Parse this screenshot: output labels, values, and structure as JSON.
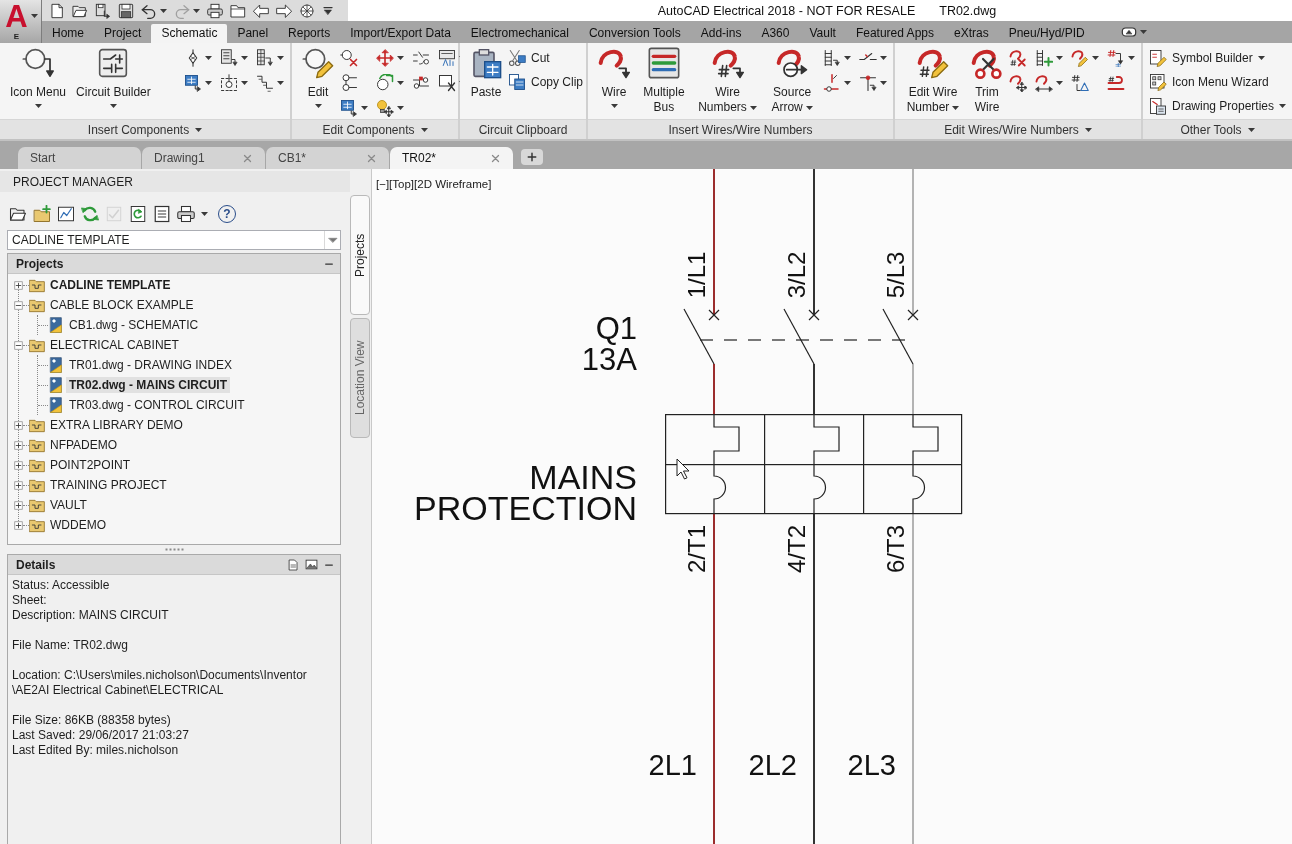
{
  "app_button": {
    "logo": "A",
    "label": "E"
  },
  "quick_access": [
    {
      "disabled": false
    },
    {
      "disabled": false
    },
    {
      "disabled": false
    },
    {
      "disabled": false
    },
    {
      "disabled": false
    },
    {
      "disabled": true
    },
    {
      "disabled": false
    },
    {
      "disabled": false
    },
    {
      "disabled": false
    },
    {
      "disabled": false
    },
    {
      "disabled": false
    }
  ],
  "window": {
    "title": "AutoCAD Electrical 2018 - NOT FOR RESALE",
    "document": "TR02.dwg"
  },
  "ribbon_tabs": [
    {
      "label": "Home",
      "selected": false
    },
    {
      "label": "Project",
      "selected": false
    },
    {
      "label": "Schematic",
      "selected": true
    },
    {
      "label": "Panel",
      "selected": false
    },
    {
      "label": "Reports",
      "selected": false
    },
    {
      "label": "Import/Export Data",
      "selected": false
    },
    {
      "label": "Electromechanical",
      "selected": false
    },
    {
      "label": "Conversion Tools",
      "selected": false
    },
    {
      "label": "Add-ins",
      "selected": false
    },
    {
      "label": "A360",
      "selected": false
    },
    {
      "label": "Vault",
      "selected": false
    },
    {
      "label": "Featured Apps",
      "selected": false
    },
    {
      "label": "eXtras",
      "selected": false
    },
    {
      "label": "Pneu/Hyd/PID",
      "selected": false
    }
  ],
  "ribbon_panels": [
    {
      "title": "Insert Components",
      "large_buttons": [
        {
          "label": "Icon Menu"
        },
        {
          "label": "Circuit Builder"
        }
      ]
    },
    {
      "title": "Edit Components",
      "large_buttons": [
        {
          "label": "Edit"
        }
      ]
    },
    {
      "title": "Circuit Clipboard",
      "large_buttons": [
        {
          "label": "Paste"
        }
      ],
      "small_buttons": [
        {
          "label": "Cut"
        },
        {
          "label": "Copy Clip"
        }
      ]
    },
    {
      "title": "Insert Wires/Wire Numbers",
      "large_buttons": [
        {
          "label": "Wire"
        },
        {
          "label": "Multiple Bus"
        },
        {
          "label": "Wire Numbers"
        },
        {
          "label": "Source Arrow"
        }
      ]
    },
    {
      "title": "Edit Wires/Wire Numbers",
      "large_buttons": [
        {
          "label": "Edit Wire Number"
        },
        {
          "label": "Trim Wire"
        }
      ]
    },
    {
      "title": "Other Tools",
      "small_buttons": [
        {
          "label": "Symbol Builder"
        },
        {
          "label": "Icon Menu Wizard"
        },
        {
          "label": "Drawing Properties"
        }
      ]
    }
  ],
  "document_tabs": [
    {
      "label": "Start",
      "selected": false,
      "closable": false
    },
    {
      "label": "Drawing1",
      "selected": false,
      "closable": true
    },
    {
      "label": "CB1*",
      "selected": false,
      "closable": true
    },
    {
      "label": "TR02*",
      "selected": true,
      "closable": true
    }
  ],
  "project_manager": {
    "title": "PROJECT MANAGER",
    "toolbar": [
      {
        "disabled": false
      },
      {
        "disabled": false
      },
      {
        "disabled": false
      },
      {
        "disabled": false
      },
      {
        "disabled": true
      },
      {
        "disabled": false
      },
      {
        "disabled": false
      },
      {
        "disabled": false
      }
    ],
    "help": "?",
    "project_select": "CADLINE TEMPLATE",
    "projects_header": "Projects",
    "projects": [
      {
        "label": "CADLINE TEMPLATE",
        "active": true,
        "expanded": false
      },
      {
        "label": "CABLE BLOCK EXAMPLE",
        "active": false,
        "expanded": true,
        "children": [
          {
            "label": "CB1.dwg - SCHEMATIC",
            "selected": false
          }
        ]
      },
      {
        "label": "ELECTRICAL CABINET",
        "active": false,
        "expanded": true,
        "children": [
          {
            "label": "TR01.dwg - DRAWING INDEX",
            "selected": false
          },
          {
            "label": "TR02.dwg - MAINS CIRCUIT",
            "selected": true
          },
          {
            "label": "TR03.dwg - CONTROL CIRCUIT",
            "selected": false
          }
        ]
      },
      {
        "label": "EXTRA LIBRARY DEMO",
        "active": false,
        "expanded": false
      },
      {
        "label": "NFPADEMO",
        "active": false,
        "expanded": false
      },
      {
        "label": "POINT2POINT",
        "active": false,
        "expanded": false
      },
      {
        "label": "TRAINING PROJECT",
        "active": false,
        "expanded": false
      },
      {
        "label": "VAULT",
        "active": false,
        "expanded": false
      },
      {
        "label": "WDDEMO",
        "active": false,
        "expanded": false
      }
    ],
    "details_header": "Details",
    "details": [
      [
        "Status: Accessible",
        "Sheet:",
        "Description: MAINS CIRCUIT"
      ],
      [
        "File Name: TR02.dwg"
      ],
      [
        "Location: C:\\Users\\miles.nicholson\\Documents\\Inventor",
        "\\AE2AI Electrical Cabinet\\ELECTRICAL"
      ],
      [
        "File Size: 86KB (88358 bytes)",
        "Last Saved: 29/06/2017 21:03:27",
        "Last Edited By: miles.nicholson"
      ]
    ]
  },
  "side_tabs": [
    {
      "label": "Projects",
      "selected": true
    },
    {
      "label": "Location View",
      "selected": false
    }
  ],
  "viewport_controls": [
    "[−]",
    "[Top]",
    "[2D Wireframe]"
  ],
  "schematic": {
    "breaker_tag": "Q1",
    "breaker_rating": "13A",
    "overload_label": "MAINS PROTECTION",
    "wires": [
      {
        "top_label": "1/L1",
        "bottom_label": "2/T1",
        "wire_number": "2L1",
        "color": "#9b2d2d"
      },
      {
        "top_label": "3/L2",
        "bottom_label": "4/T2",
        "wire_number": "2L2",
        "color": "#333333"
      },
      {
        "top_label": "5/L3",
        "bottom_label": "6/T3",
        "wire_number": "2L3",
        "color": "#b3b3b3"
      }
    ]
  }
}
